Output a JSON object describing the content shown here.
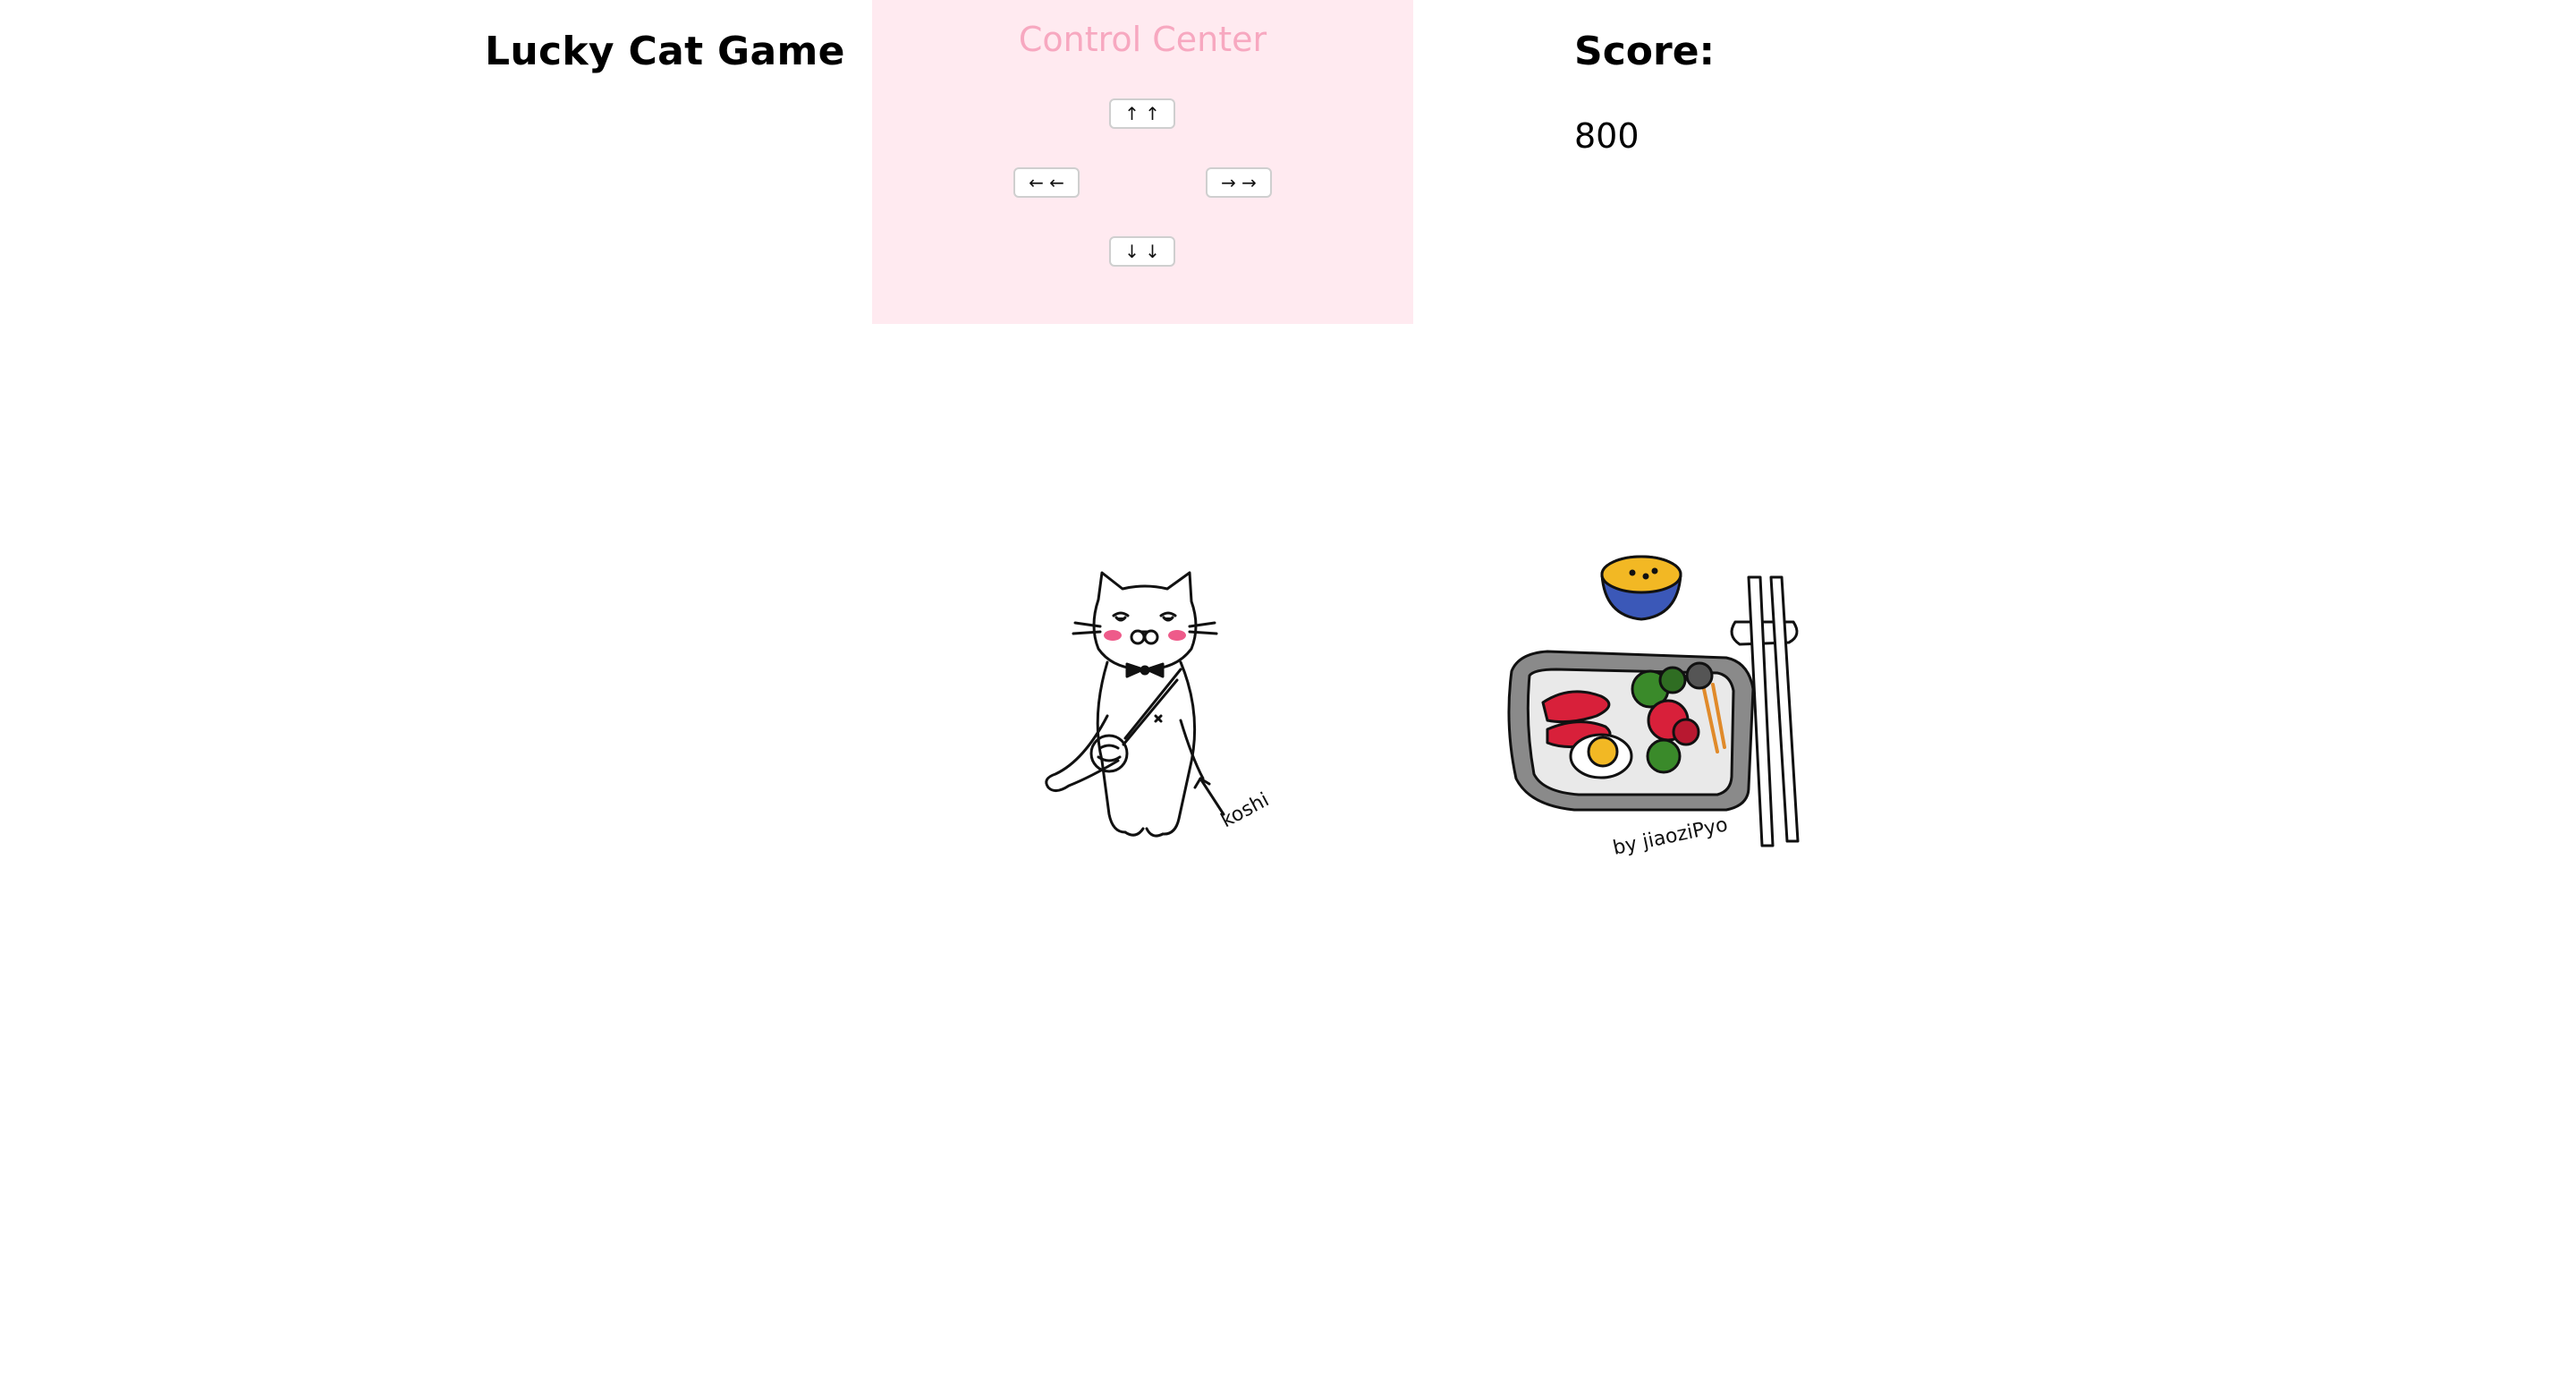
{
  "header": {
    "title": "Lucky Cat Game"
  },
  "control_center": {
    "title": "Control Center",
    "buttons": {
      "up": "↑ ↑",
      "left": "← ←",
      "right": "→ →",
      "down": "↓ ↓"
    }
  },
  "score": {
    "label": "Score:",
    "value": "800"
  },
  "sprites": {
    "cat": {
      "icon": "lucky-cat-drawing",
      "signature": "koshi"
    },
    "food": {
      "icon": "bento-box-drawing",
      "signature": "by jiaoziPyo"
    }
  },
  "colors": {
    "control_bg": "#ffeaf0",
    "control_title": "#f7a8c0",
    "cat_blush": "#ee5b8a",
    "bento_red": "#d8203a",
    "bento_green": "#3a8a2a",
    "egg_yolk": "#f2b824",
    "bowl_blue": "#3b58b8"
  }
}
